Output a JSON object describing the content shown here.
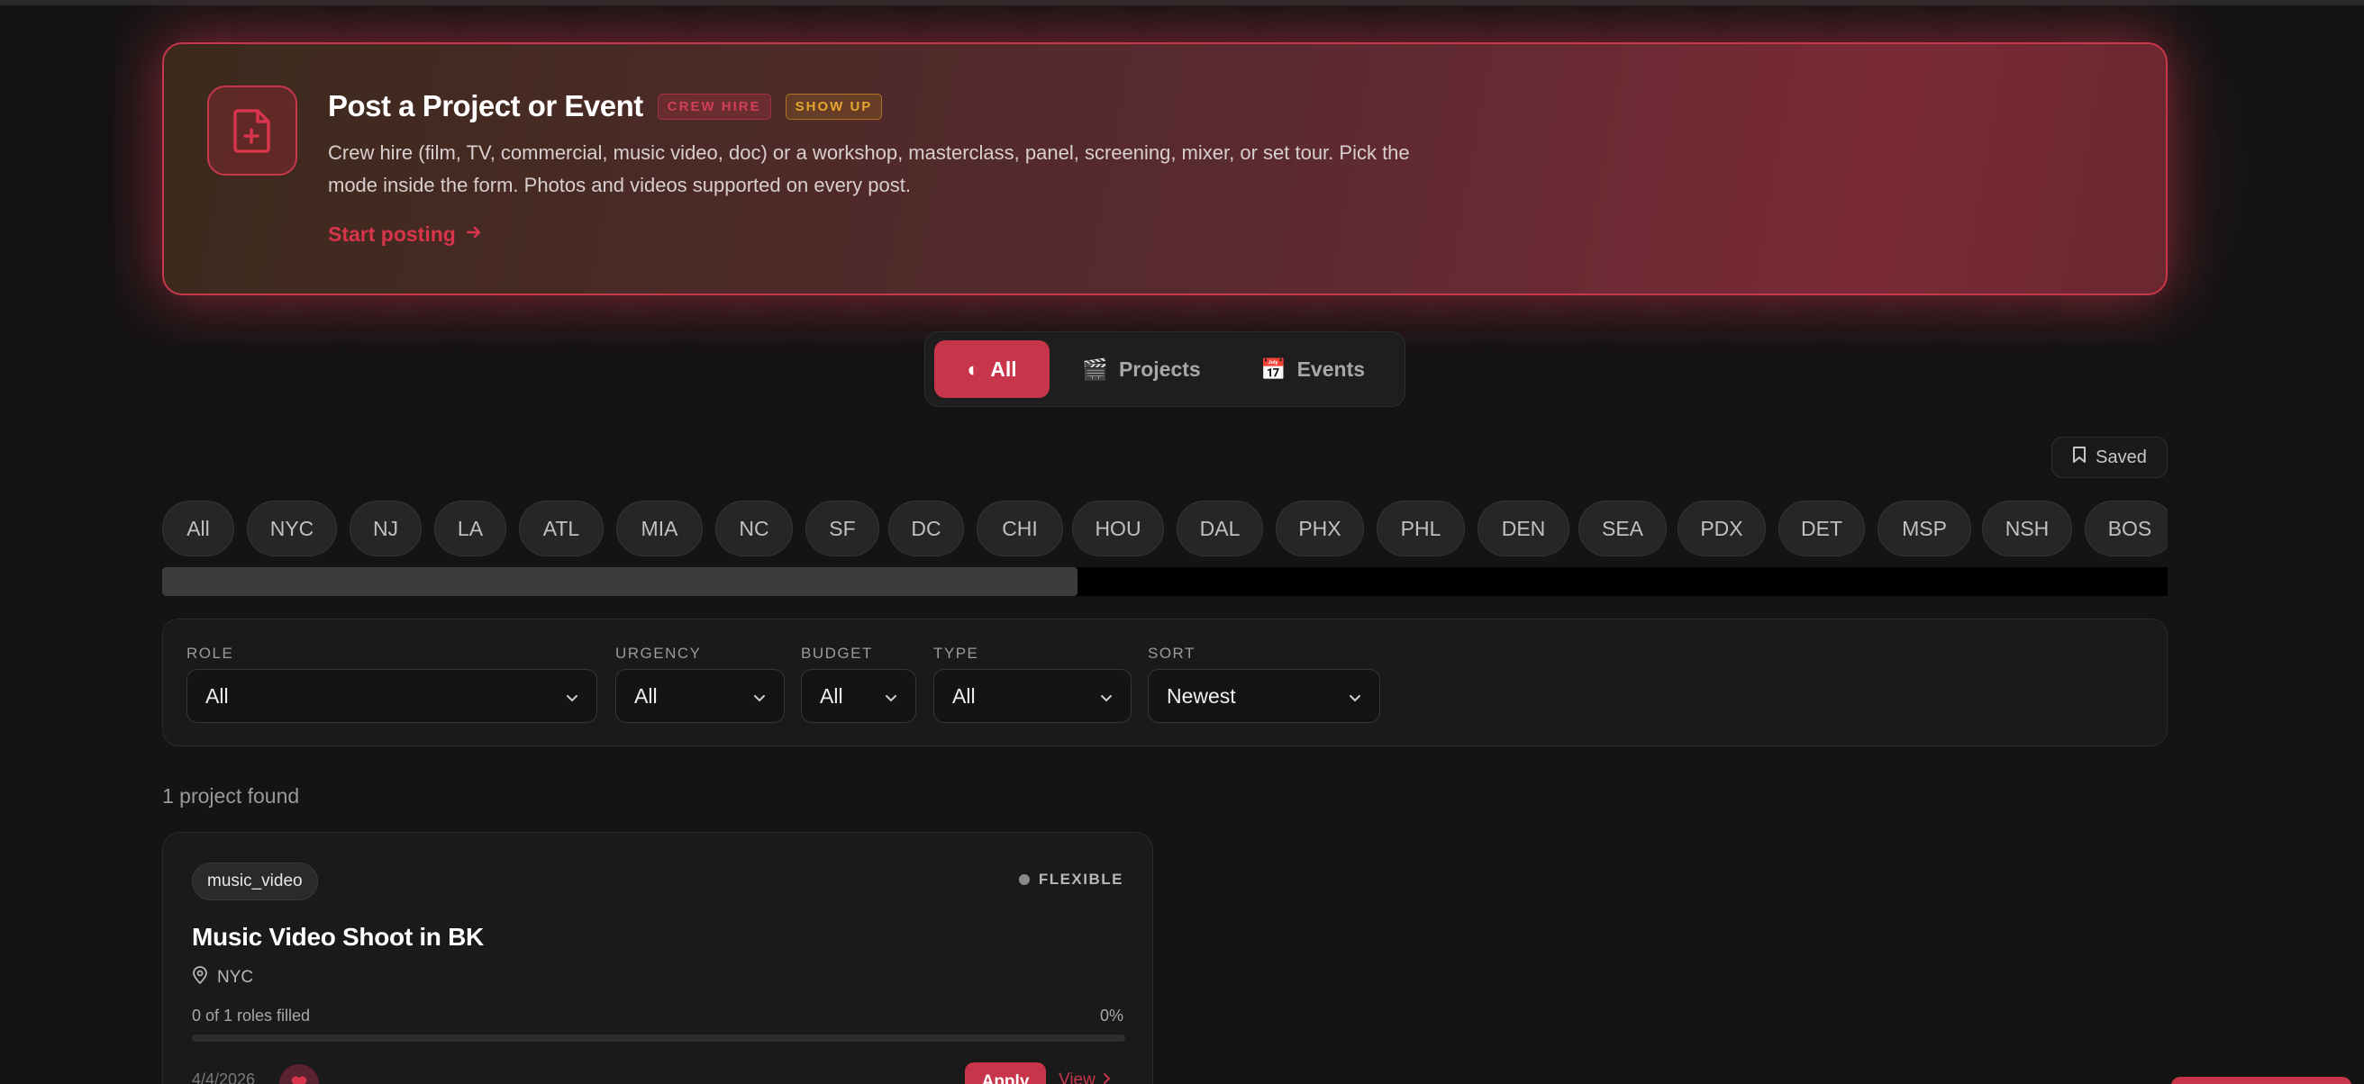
{
  "hero": {
    "icon": "file-plus-icon",
    "title": "Post a Project or Event",
    "badge_crew": "CREW HIRE",
    "badge_show": "SHOW UP",
    "description": "Crew hire (film, TV, commercial, music video, doc) or a workshop, masterclass, panel, screening, mixer, or set tour. Pick the mode inside the form. Photos and videos supported on every post.",
    "cta": "Start posting",
    "cta_icon": "arrow-right-icon"
  },
  "segment": {
    "all": {
      "icon": "◐",
      "label": "All"
    },
    "projects": {
      "icon": "🎬",
      "label": "Projects"
    },
    "events": {
      "icon": "📅",
      "label": "Events"
    }
  },
  "saved": {
    "icon": "bookmark-icon",
    "label": "Saved"
  },
  "cities": [
    "All",
    "NYC",
    "NJ",
    "LA",
    "ATL",
    "MIA",
    "NC",
    "SF",
    "DC",
    "CHI",
    "HOU",
    "DAL",
    "PHX",
    "PHL",
    "DEN",
    "SEA",
    "PDX",
    "DET",
    "MSP",
    "NSH",
    "BOS"
  ],
  "filters": {
    "role": {
      "label": "ROLE",
      "value": "All"
    },
    "urgency": {
      "label": "URGENCY",
      "value": "All"
    },
    "budget": {
      "label": "BUDGET",
      "value": "All"
    },
    "type": {
      "label": "TYPE",
      "value": "All"
    },
    "sort": {
      "label": "SORT",
      "value": "Newest"
    }
  },
  "results": {
    "count_text": "1 project found"
  },
  "card": {
    "tag": "music_video",
    "urgency": "FLEXIBLE",
    "title": "Music Video Shoot in BK",
    "location": "NYC",
    "roles_text": "0 of 1 roles filled",
    "roles_pct": "0%",
    "progress": 0,
    "date": "4/4/2026",
    "apply": "Apply",
    "view": "View"
  },
  "colors": {
    "accent": "#c7354a",
    "gold": "#e6a52e",
    "background": "#141414"
  }
}
